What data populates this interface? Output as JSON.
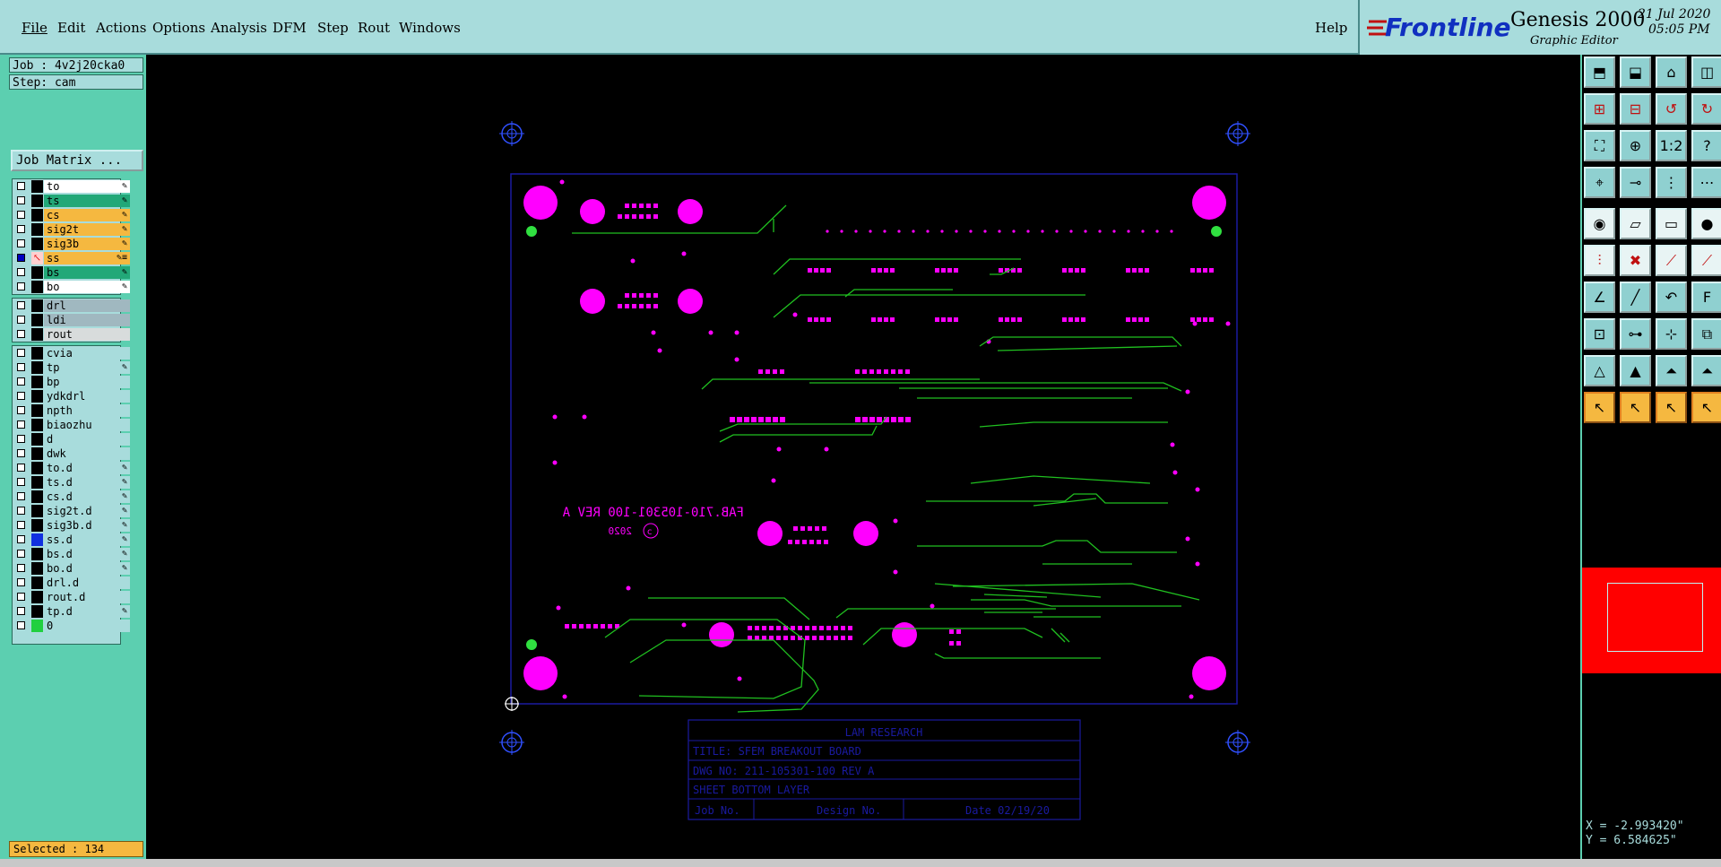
{
  "menu": {
    "file": "File",
    "edit": "Edit",
    "actions": "Actions",
    "options": "Options",
    "analysis": "Analysis",
    "dfm": "DFM",
    "step": "Step",
    "rout": "Rout",
    "windows": "Windows",
    "help": "Help"
  },
  "brand": {
    "logo": "Frontline",
    "product": "Genesis 2000",
    "subtitle": "Graphic Editor",
    "date": "21 Jul 2020",
    "time": "05:05 PM"
  },
  "job": {
    "job": "Job : 4v2j20cka0",
    "step": "Step: cam",
    "matrix_button": "Job Matrix ..."
  },
  "layers_board": [
    {
      "name": "to",
      "color": "#ffffff",
      "flag": "✎"
    },
    {
      "name": "ts",
      "color": "#22a878",
      "flag": "✎"
    },
    {
      "name": "cs",
      "color": "#f5b840",
      "flag": "✎"
    },
    {
      "name": "sig2t",
      "color": "#f5b840",
      "flag": "✎"
    },
    {
      "name": "sig3b",
      "color": "#f5b840",
      "flag": "✎"
    },
    {
      "name": "ss",
      "color": "#f5b840",
      "flag": "✎≡",
      "active": true
    },
    {
      "name": "bs",
      "color": "#22a878",
      "flag": "✎"
    },
    {
      "name": "bo",
      "color": "#ffffff",
      "flag": "✎"
    }
  ],
  "layers_drill": [
    {
      "name": "drl",
      "color": "#a0b8c0",
      "flag": ""
    },
    {
      "name": "ldi",
      "color": "#a0b8c0",
      "flag": ""
    },
    {
      "name": "rout",
      "color": "#d8dcdc",
      "flag": ""
    }
  ],
  "layers_misc": [
    {
      "name": "cvia",
      "color": "#a8dcdc",
      "flag": ""
    },
    {
      "name": "tp",
      "color": "#a8dcdc",
      "flag": "✎"
    },
    {
      "name": "bp",
      "color": "#a8dcdc",
      "flag": ""
    },
    {
      "name": "ydkdrl",
      "color": "#a8dcdc",
      "flag": ""
    },
    {
      "name": "npth",
      "color": "#a8dcdc",
      "flag": ""
    },
    {
      "name": "biaozhu",
      "color": "#a8dcdc",
      "flag": ""
    },
    {
      "name": "d",
      "color": "#a8dcdc",
      "flag": ""
    },
    {
      "name": "dwk",
      "color": "#a8dcdc",
      "flag": ""
    },
    {
      "name": "to.d",
      "color": "#a8dcdc",
      "flag": "✎"
    },
    {
      "name": "ts.d",
      "color": "#a8dcdc",
      "flag": "✎"
    },
    {
      "name": "cs.d",
      "color": "#a8dcdc",
      "flag": "✎"
    },
    {
      "name": "sig2t.d",
      "color": "#a8dcdc",
      "flag": "✎"
    },
    {
      "name": "sig3b.d",
      "color": "#a8dcdc",
      "flag": "✎"
    },
    {
      "name": "ss.d",
      "color": "#a8dcdc",
      "flag": "✎",
      "swatch": "#1030e0"
    },
    {
      "name": "bs.d",
      "color": "#a8dcdc",
      "flag": "✎"
    },
    {
      "name": "bo.d",
      "color": "#a8dcdc",
      "flag": "✎"
    },
    {
      "name": "drl.d",
      "color": "#a8dcdc",
      "flag": ""
    },
    {
      "name": "rout.d",
      "color": "#a8dcdc",
      "flag": ""
    },
    {
      "name": "tp.d",
      "color": "#a8dcdc",
      "flag": "✎"
    },
    {
      "name": "0",
      "color": "#a8dcdc",
      "flag": "",
      "swatch": "#20d040"
    }
  ],
  "status": {
    "selected": "Selected : 134"
  },
  "coords": {
    "x": "X = -2.993420\"",
    "y": "Y = 6.584625\""
  },
  "board": {
    "silk_text": "FAB.710-105301-100 REV A",
    "silk_year": "2020",
    "tb_company": "LAM RESEARCH",
    "tb_title": "TITLE:  SFEM BREAKOUT BOARD",
    "tb_dwg": "DWG NO: 211-105301-100 REV A",
    "tb_sheet": "SHEET  BOTTOM LAYER",
    "tb_jobno": "Job No.",
    "tb_designno": "Design No.",
    "tb_date": "Date 02/19/20"
  },
  "colors": {
    "pad": "#ff00ff",
    "trace": "#20c020",
    "outline": "#1a1aa0",
    "tb_text": "#1a1aa0"
  }
}
